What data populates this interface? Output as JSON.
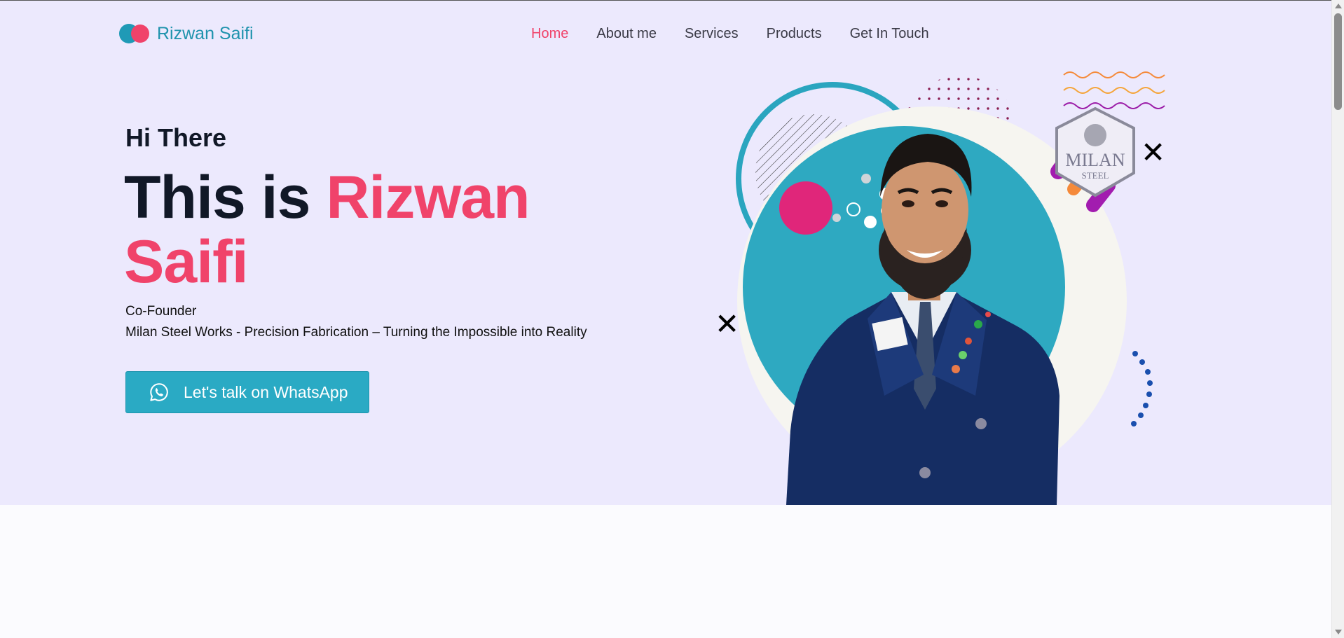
{
  "header": {
    "brand": "Rizwan Saifi",
    "nav": [
      {
        "label": "Home",
        "active": true
      },
      {
        "label": "About me",
        "active": false
      },
      {
        "label": "Services",
        "active": false
      },
      {
        "label": "Products",
        "active": false
      },
      {
        "label": "Get In Touch",
        "active": false
      }
    ]
  },
  "hero": {
    "greeting": "Hi There",
    "headline_prefix": "This is",
    "headline_name": "Rizwan Saifi",
    "role": "Co-Founder",
    "company": "Milan Steel Works - Precision Fabrication – Turning the Impossible into Reality",
    "cta_label": "Let's talk on WhatsApp",
    "cta_icon": "whatsapp-icon",
    "close_icon_glyph": "✕",
    "badge": {
      "line1": "MILAN",
      "line2": "STEEL"
    }
  },
  "colors": {
    "accent": "#f0436a",
    "brand": "#1f93ad",
    "hero_bg": "#ece9fd",
    "button": "#2aaac4",
    "heading": "#111827"
  }
}
